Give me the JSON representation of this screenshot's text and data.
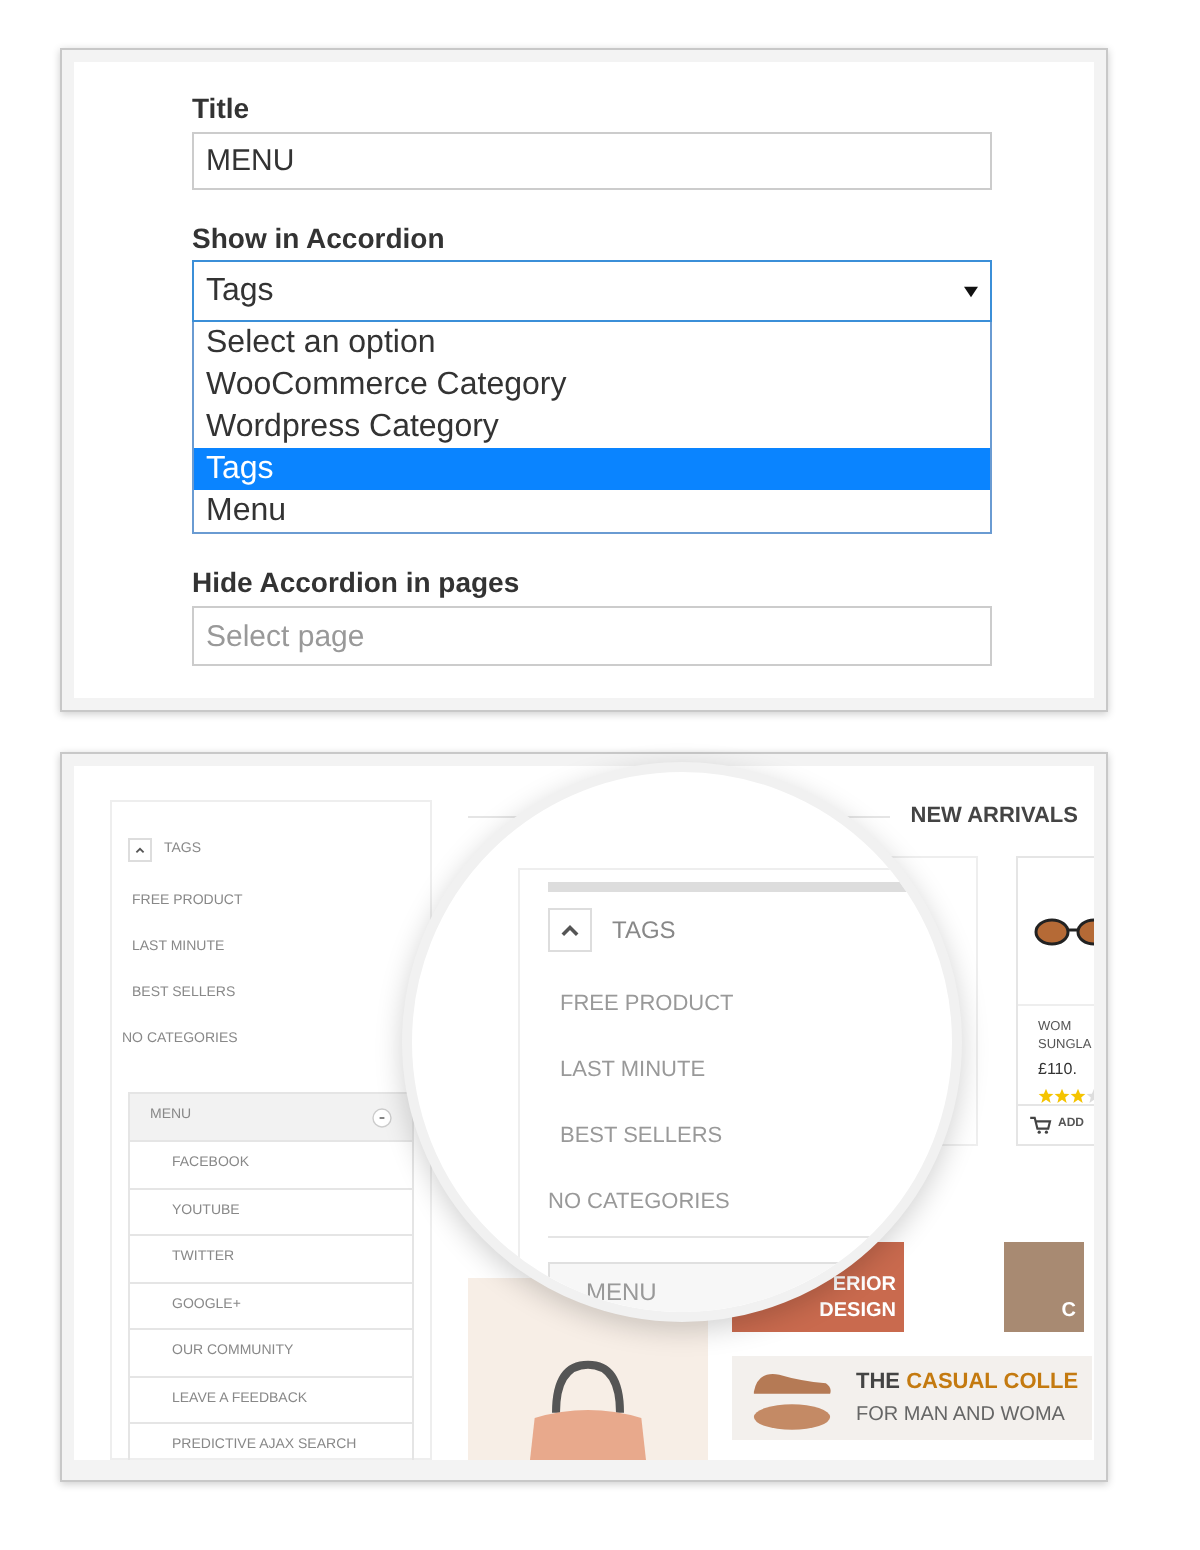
{
  "settings_form": {
    "title_field": {
      "label": "Title",
      "value": "MENU"
    },
    "accordion_select": {
      "label": "Show in Accordion",
      "value": "Tags",
      "expanded": true,
      "options": [
        {
          "label": "Select an option",
          "selected": false
        },
        {
          "label": "WooCommerce Category",
          "selected": false
        },
        {
          "label": "Wordpress Category",
          "selected": false
        },
        {
          "label": "Tags",
          "selected": true
        },
        {
          "label": "Menu",
          "selected": false
        }
      ]
    },
    "pages_field": {
      "label": "Hide Accordion in pages",
      "placeholder": "Select page"
    }
  },
  "preview": {
    "sidebar": {
      "tags_title": "TAGS",
      "tags_expanded": true,
      "tags": [
        "FREE PRODUCT",
        "LAST MINUTE",
        "BEST SELLERS",
        "NO CATEGORIES"
      ],
      "menu": {
        "title": "MENU",
        "expanded": true,
        "items": [
          "FACEBOOK",
          "YOUTUBE",
          "TWITTER",
          "GOOGLE+",
          "OUR COMMUNITY",
          "LEAVE A FEEDBACK",
          "PREDICTIVE AJAX SEARCH"
        ]
      }
    },
    "magnifier": {
      "tags_title": "TAGS",
      "tags_expanded": true,
      "tags": [
        "FREE PRODUCT",
        "LAST MINUTE",
        "BEST SELLERS",
        "NO CATEGORIES"
      ],
      "menu_title": "MENU"
    },
    "section_title": "NEW ARRIVALS",
    "product": {
      "name_lines": [
        "WOM",
        "SUNGLA"
      ],
      "price": "£110.",
      "stars": 3,
      "cart_label": "ADD"
    },
    "banners": [
      {
        "lines": [
          "ERIOR",
          "DESIGN"
        ]
      },
      {
        "lines": [
          "C"
        ]
      }
    ],
    "promo": {
      "title_prefix": "THE",
      "title_highlight": "CASUAL COLLE",
      "subtitle": "FOR MAN AND WOMA"
    }
  }
}
